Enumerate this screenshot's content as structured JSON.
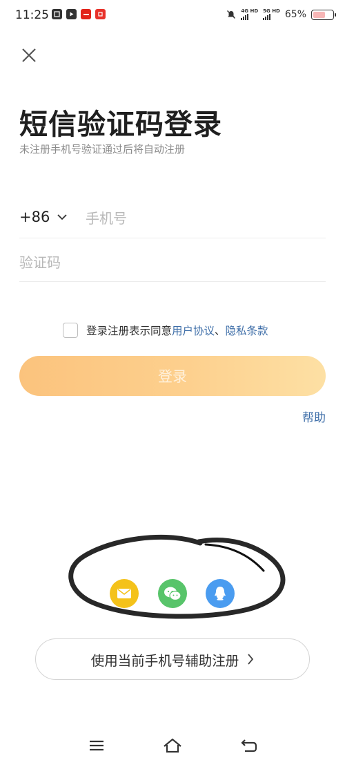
{
  "status_bar": {
    "time": "11:25",
    "network_1": "4G HD",
    "network_2": "5G HD",
    "battery_percent": "65%",
    "battery_level": 0.65
  },
  "header": {
    "title": "短信验证码登录",
    "subtitle": "未注册手机号验证通过后将自动注册"
  },
  "form": {
    "country_code": "+86",
    "phone_placeholder": "手机号",
    "code_placeholder": "验证码"
  },
  "agreement": {
    "prefix": "登录注册表示同意",
    "user_agreement": "用户协议",
    "separator": "、",
    "privacy_terms": "隐私条款"
  },
  "login_button": "登录",
  "help_link": "帮助",
  "assist_button": "使用当前手机号辅助注册",
  "colors": {
    "accent_link": "#3e6ea8",
    "login_gradient_start": "#fbc37d",
    "login_gradient_end": "#fde0a4",
    "mail_icon_bg": "#f4c21a",
    "wechat_icon_bg": "#58c46a",
    "qq_icon_bg": "#4a9cf0"
  },
  "social_icons": [
    "mail-icon",
    "wechat-icon",
    "qq-icon"
  ]
}
